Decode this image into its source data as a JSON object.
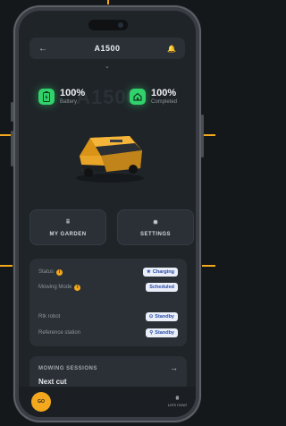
{
  "header": {
    "title": "A1500",
    "back_icon": "←",
    "bell_icon": "🔔"
  },
  "chevron": "⌄",
  "ghost_text": "A1500",
  "stats": [
    {
      "value": "100%",
      "label": "Battery"
    },
    {
      "value": "100%",
      "label": "Completed"
    }
  ],
  "nav": {
    "garden_icon": "⩩",
    "garden_label": "MY GARDEN",
    "settings_icon": "✹",
    "settings_label": "SETTINGS"
  },
  "status": {
    "status_label": "Status",
    "status_value": "Charging",
    "mowing_label": "Mowing Mode",
    "mowing_value": "Scheduled",
    "rtk_label": "Rtk robot",
    "rtk_value": "Standby",
    "ref_label": "Reference station",
    "ref_value": "Standby"
  },
  "sessions": {
    "header": "MOWING SESSIONS",
    "next_cut": "Next cut",
    "arrow": "→"
  },
  "bottom": {
    "go_label": "GO",
    "pos_label": "Let's mow!"
  },
  "colors": {
    "accent": "#f3a81d",
    "battery_green": "#31d16b",
    "background": "#1f2428",
    "card": "#2a3036"
  }
}
